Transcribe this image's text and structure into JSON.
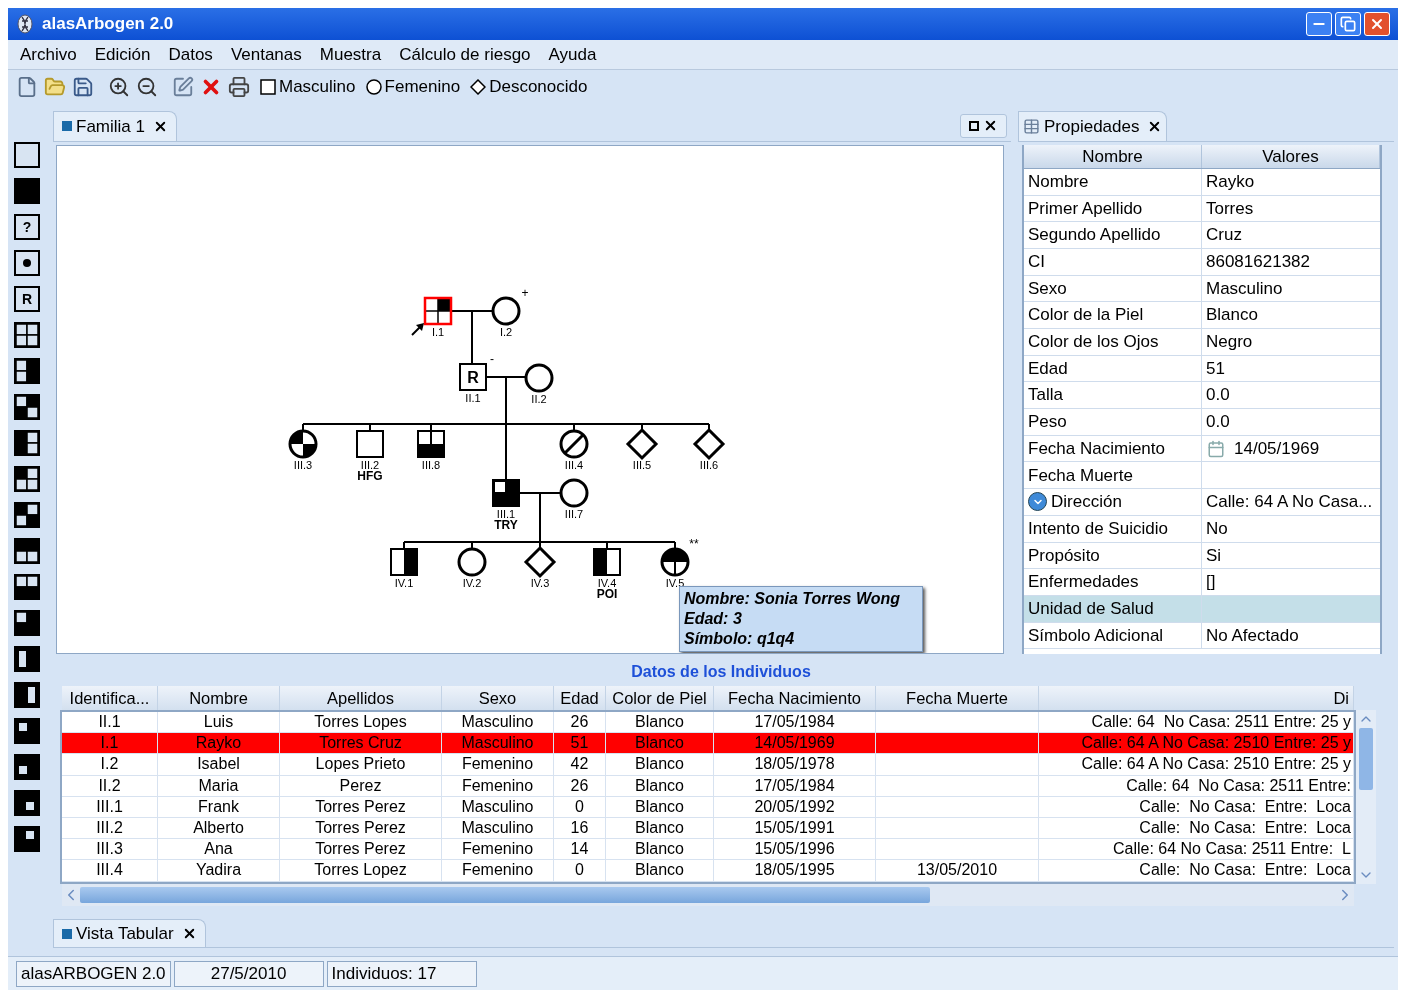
{
  "window": {
    "title": "alasArbogen 2.0"
  },
  "menu": [
    "Archivo",
    "Edición",
    "Datos",
    "Ventanas",
    "Muestra",
    "Cálculo de riesgo",
    "Ayuda"
  ],
  "toolbar": {
    "tools": [
      {
        "kind": "new"
      },
      {
        "kind": "open"
      },
      {
        "kind": "save"
      },
      {
        "kind": "zoom-in"
      },
      {
        "kind": "zoom-out"
      },
      {
        "kind": "edit"
      },
      {
        "kind": "delete"
      },
      {
        "kind": "print"
      }
    ],
    "sexes": [
      {
        "kind": "square",
        "label": "Masculino"
      },
      {
        "kind": "circle",
        "label": "Femenino"
      },
      {
        "kind": "diamond",
        "label": "Desconocido"
      }
    ]
  },
  "palette": [
    {
      "kind": "empty"
    },
    {
      "kind": "full"
    },
    {
      "kind": "glyph",
      "glyph": "?"
    },
    {
      "kind": "dot"
    },
    {
      "kind": "glyph",
      "glyph": "R"
    },
    {
      "kind": "grid"
    },
    {
      "kind": "grid-right"
    },
    {
      "kind": "grid-antidiagonal"
    },
    {
      "kind": "grid-left"
    },
    {
      "kind": "grid-topleft"
    },
    {
      "kind": "grid-diagonal"
    },
    {
      "kind": "grid-top"
    },
    {
      "kind": "grid-bottom"
    },
    {
      "kind": "grid-three"
    },
    {
      "kind": "bar-left"
    },
    {
      "kind": "bar-right"
    },
    {
      "kind": "corner-tl"
    },
    {
      "kind": "corner-bl"
    },
    {
      "kind": "corner-br"
    },
    {
      "kind": "corner-tr"
    }
  ],
  "document": {
    "tab": {
      "label": "Familia 1"
    },
    "pedigree": {
      "nodes": [
        {
          "label": "I.1",
          "kind": "square-quartertr",
          "selected": true,
          "proband": true
        },
        {
          "label": "I.2",
          "kind": "circle",
          "selected": false,
          "mark": "+"
        },
        {
          "label": "II.1",
          "kind": "square-glyph",
          "glyph": "R",
          "selected": false,
          "mark": "-"
        },
        {
          "label": "II.2",
          "kind": "circle",
          "selected": false
        },
        {
          "label": "III.3",
          "kind": "circle-diagonal",
          "selected": false
        },
        {
          "label": "III.2",
          "kind": "square",
          "selected": false,
          "tag": "HFG"
        },
        {
          "label": "III.8",
          "kind": "square-bottomsplit",
          "selected": false
        },
        {
          "label": "III.4",
          "kind": "circle-slash",
          "selected": false
        },
        {
          "label": "III.5",
          "kind": "diamond",
          "selected": false
        },
        {
          "label": "III.6",
          "kind": "diamond",
          "selected": false
        },
        {
          "label": "III.1",
          "kind": "square-threequarters",
          "selected": false,
          "tag": "TRY"
        },
        {
          "label": "III.7",
          "kind": "circle",
          "selected": false
        },
        {
          "label": "IV.1",
          "kind": "square-righthalf",
          "selected": false
        },
        {
          "label": "IV.2",
          "kind": "circle",
          "selected": false
        },
        {
          "label": "IV.3",
          "kind": "diamond",
          "selected": false
        },
        {
          "label": "IV.4",
          "kind": "square-lefthalf",
          "selected": false,
          "tag": "POI"
        },
        {
          "label": "IV.5",
          "kind": "circle-topsplit",
          "selected": false,
          "mark": "**"
        }
      ]
    },
    "tooltip": {
      "lines": [
        "Nombre: Sonia Torres Wong",
        "Edad: 3",
        "Símbolo: q1q4"
      ]
    }
  },
  "properties": {
    "title": "Propiedades",
    "columns": [
      "Nombre",
      "Valores"
    ],
    "rows": [
      {
        "kind": "text",
        "name": "Nombre",
        "value": "Rayko",
        "selected": false
      },
      {
        "kind": "text",
        "name": "Primer Apellido",
        "value": "Torres",
        "selected": false
      },
      {
        "kind": "text",
        "name": "Segundo Apellido",
        "value": "Cruz",
        "selected": false
      },
      {
        "kind": "text",
        "name": "CI",
        "value": "86081621382",
        "selected": false
      },
      {
        "kind": "text",
        "name": "Sexo",
        "value": "Masculino",
        "selected": false
      },
      {
        "kind": "text",
        "name": "Color de la Piel",
        "value": "Blanco",
        "selected": false
      },
      {
        "kind": "text",
        "name": "Color de los Ojos",
        "value": "Negro",
        "selected": false
      },
      {
        "kind": "text",
        "name": "Edad",
        "value": "51",
        "selected": false
      },
      {
        "kind": "text",
        "name": "Talla",
        "value": "0.0",
        "selected": false
      },
      {
        "kind": "text",
        "name": "Peso",
        "value": "0.0",
        "selected": false
      },
      {
        "kind": "date",
        "name": "Fecha Nacimiento",
        "value": "14/05/1969",
        "selected": false
      },
      {
        "kind": "text",
        "name": "Fecha Muerte",
        "selected": false
      },
      {
        "kind": "group",
        "name": "Dirección",
        "value": "Calle: 64 A No Casa...",
        "selected": false
      },
      {
        "kind": "text",
        "name": "Intento de Suicidio",
        "value": "No",
        "selected": false
      },
      {
        "kind": "text",
        "name": "Propósito",
        "value": "Si",
        "selected": false
      },
      {
        "kind": "text",
        "name": "Enfermedades",
        "value": "[]",
        "selected": false
      },
      {
        "kind": "text",
        "name": "Unidad de Salud",
        "selected": true
      },
      {
        "kind": "text",
        "name": "Símbolo Adicional",
        "value": "No Afectado",
        "selected": false
      }
    ]
  },
  "table": {
    "title": "Datos de los Individuos",
    "columns": [
      "Identifica...",
      "Nombre",
      "Apellidos",
      "Sexo",
      "Edad",
      "Color de Piel",
      "Fecha Nacimiento",
      "Fecha Muerte",
      "Di"
    ],
    "rows": [
      {
        "selected": false,
        "cells": [
          "II.1",
          "Luis",
          "Torres Lopes",
          "Masculino",
          "26",
          "Blanco",
          "17/05/1984",
          null,
          "Calle: 64  No Casa: 2511 Entre: 25 y"
        ]
      },
      {
        "selected": true,
        "cells": [
          "I.1",
          "Rayko",
          "Torres Cruz",
          "Masculino",
          "51",
          "Blanco",
          "14/05/1969",
          null,
          "Calle: 64 A No Casa: 2510 Entre: 25 y"
        ]
      },
      {
        "selected": false,
        "cells": [
          "I.2",
          "Isabel",
          "Lopes Prieto",
          "Femenino",
          "42",
          "Blanco",
          "18/05/1978",
          null,
          "Calle: 64 A No Casa: 2510 Entre: 25 y"
        ]
      },
      {
        "selected": false,
        "cells": [
          "II.2",
          "Maria",
          "Perez",
          "Femenino",
          "26",
          "Blanco",
          "17/05/1984",
          null,
          "Calle: 64  No Casa: 2511 Entre:"
        ]
      },
      {
        "selected": false,
        "cells": [
          "III.1",
          "Frank",
          "Torres Perez",
          "Masculino",
          "0",
          "Blanco",
          "20/05/1992",
          null,
          "Calle:  No Casa:  Entre:  Loca"
        ]
      },
      {
        "selected": false,
        "cells": [
          "III.2",
          "Alberto",
          "Torres Perez",
          "Masculino",
          "16",
          "Blanco",
          "15/05/1991",
          null,
          "Calle:  No Casa:  Entre:  Loca"
        ]
      },
      {
        "selected": false,
        "cells": [
          "III.3",
          "Ana",
          "Torres Perez",
          "Femenino",
          "14",
          "Blanco",
          "15/05/1996",
          null,
          "Calle: 64 No Casa: 2511 Entre:  L"
        ]
      },
      {
        "selected": false,
        "cells": [
          "III.4",
          "Yadira",
          "Torres Lopez",
          "Femenino",
          "0",
          "Blanco",
          "18/05/1995",
          "13/05/2010",
          "Calle:  No Casa:  Entre:  Loca"
        ]
      }
    ]
  },
  "bottom_tab": {
    "label": "Vista Tabular"
  },
  "status_bar": [
    "alasARBOGEN 2.0",
    "27/5/2010",
    "Individuos: 17"
  ]
}
